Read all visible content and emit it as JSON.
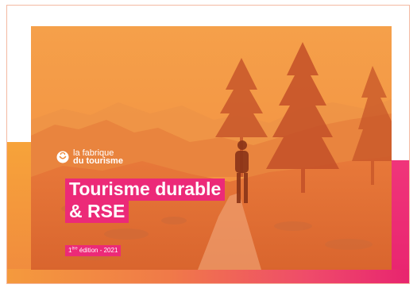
{
  "brand": {
    "logo_line1": "la fabrique",
    "logo_line2": "du tourisme"
  },
  "cover": {
    "title_line1": "Tourisme durable",
    "title_line2": "& RSE",
    "edition_ordinal": "1",
    "edition_suffix": "ère",
    "edition_rest": " édition - 2021"
  },
  "colors": {
    "accent_pink": "#ec2a78",
    "overlay_orange": "#f08a3a",
    "strip_orange": "#f7a33a"
  },
  "icons": {
    "logo": "smile-bag-icon"
  }
}
